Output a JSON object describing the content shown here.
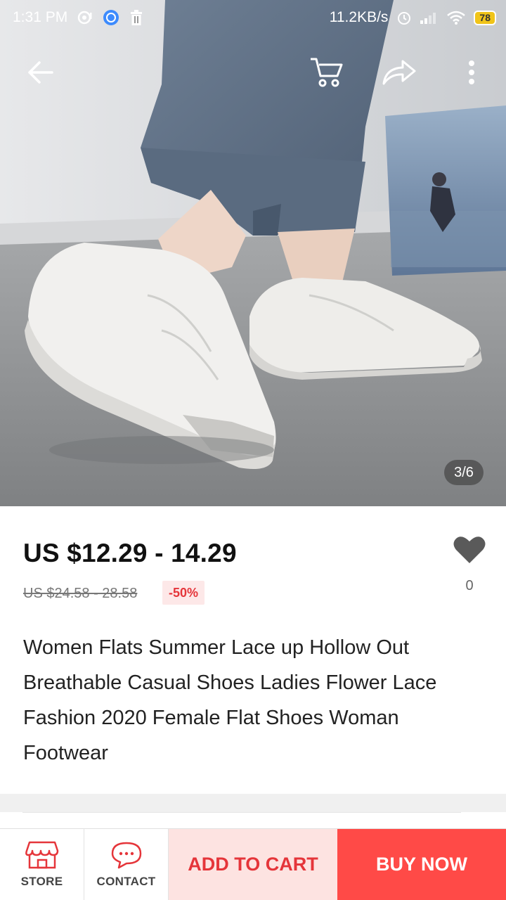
{
  "status_bar": {
    "time": "1:31 PM",
    "net_speed": "11.2KB/s",
    "battery": "78"
  },
  "gallery": {
    "counter": "3/6"
  },
  "product": {
    "price": "US $12.29 - 14.29",
    "original_price": "US $24.58 - 28.58",
    "discount": "-50%",
    "wishlist_count": "0",
    "title": "Women Flats Summer Lace up Hollow Out Breathable Casual Shoes Ladies Flower Lace Fashion 2020 Female Flat Shoes Woman Footwear"
  },
  "bottom_bar": {
    "store_label": "STORE",
    "contact_label": "CONTACT",
    "add_to_cart_label": "ADD TO CART",
    "buy_now_label": "BUY NOW"
  },
  "colors": {
    "accent": "#e5353a",
    "buy_now_bg": "#ff4a47",
    "add_cart_bg": "#fde3e1"
  },
  "icons": [
    "back-arrow-icon",
    "cart-icon",
    "share-icon",
    "more-vert-icon",
    "heart-icon",
    "store-icon",
    "chat-icon"
  ]
}
